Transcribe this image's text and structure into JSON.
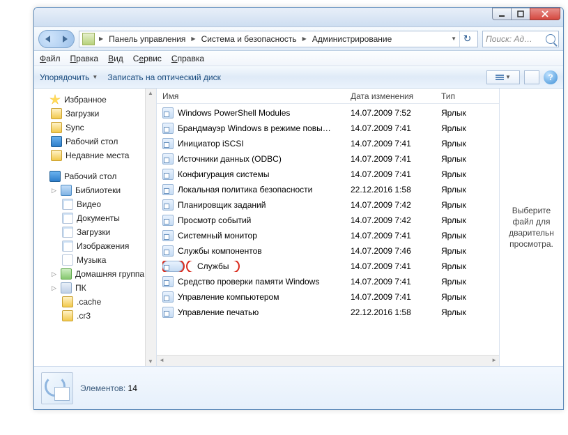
{
  "breadcrumb": {
    "root_icon": "control-panel-icon",
    "items": [
      "Панель управления",
      "Система и безопасность",
      "Администрирование"
    ]
  },
  "search": {
    "placeholder": "Поиск: Ад…"
  },
  "menu": {
    "file": "Файл",
    "edit": "Правка",
    "view": "Вид",
    "tools": "Сервис",
    "help": "Справка"
  },
  "toolbar": {
    "organize": "Упорядочить",
    "burn": "Записать на оптический диск"
  },
  "columns": {
    "name": "Имя",
    "date": "Дата изменения",
    "type": "Тип"
  },
  "sidebar": {
    "fav_header": "Избранное",
    "fav": [
      "Загрузки",
      "Sync",
      "Рабочий стол",
      "Недавние места"
    ],
    "desktop": "Рабочий стол",
    "lib_header": "Библиотеки",
    "libs": [
      "Видео",
      "Документы",
      "Загрузки",
      "Изображения",
      "Музыка"
    ],
    "homegroup": "Домашняя группа",
    "pc": "ПК",
    "pc_children": [
      ".cache",
      ".cr3"
    ]
  },
  "files": [
    {
      "name": "Windows PowerShell Modules",
      "date": "14.07.2009 7:52",
      "type": "Ярлык"
    },
    {
      "name": "Брандмауэр Windows в режиме повы…",
      "date": "14.07.2009 7:41",
      "type": "Ярлык"
    },
    {
      "name": "Инициатор iSCSI",
      "date": "14.07.2009 7:41",
      "type": "Ярлык"
    },
    {
      "name": "Источники данных (ODBC)",
      "date": "14.07.2009 7:41",
      "type": "Ярлык"
    },
    {
      "name": "Конфигурация системы",
      "date": "14.07.2009 7:41",
      "type": "Ярлык"
    },
    {
      "name": "Локальная политика безопасности",
      "date": "22.12.2016 1:58",
      "type": "Ярлык"
    },
    {
      "name": "Планировщик заданий",
      "date": "14.07.2009 7:42",
      "type": "Ярлык"
    },
    {
      "name": "Просмотр событий",
      "date": "14.07.2009 7:42",
      "type": "Ярлык"
    },
    {
      "name": "Системный монитор",
      "date": "14.07.2009 7:41",
      "type": "Ярлык"
    },
    {
      "name": "Службы компонентов",
      "date": "14.07.2009 7:46",
      "type": "Ярлык"
    },
    {
      "name": "Службы",
      "date": "14.07.2009 7:41",
      "type": "Ярлык",
      "highlight": true
    },
    {
      "name": "Средство проверки памяти Windows",
      "date": "14.07.2009 7:41",
      "type": "Ярлык"
    },
    {
      "name": "Управление компьютером",
      "date": "14.07.2009 7:41",
      "type": "Ярлык"
    },
    {
      "name": "Управление печатью",
      "date": "22.12.2016 1:58",
      "type": "Ярлык"
    }
  ],
  "preview": {
    "text": "Выберите файл для дварительн просмотра."
  },
  "status": {
    "label": "Элементов:",
    "count": "14"
  }
}
